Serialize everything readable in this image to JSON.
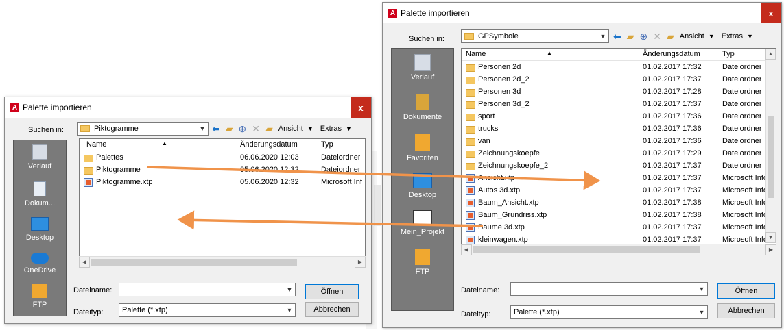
{
  "left_dialog": {
    "title": "Palette importieren",
    "close_label": "x",
    "look_in_label": "Suchen in:",
    "look_in_value": "Piktogramme",
    "view_label": "Ansicht",
    "extras_label": "Extras",
    "places": [
      {
        "label": "Verlauf",
        "icon": "history-icon"
      },
      {
        "label": "Dokum...",
        "icon": "documents-icon"
      },
      {
        "label": "Desktop",
        "icon": "desktop-icon"
      },
      {
        "label": "OneDrive",
        "icon": "onedrive-icon"
      },
      {
        "label": "FTP",
        "icon": "ftp-icon"
      }
    ],
    "columns": [
      "Name",
      "Änderungsdatum",
      "Typ"
    ],
    "rows": [
      {
        "name": "Palettes",
        "date": "06.06.2020 12:03",
        "type": "Dateiordner",
        "kind": "folder"
      },
      {
        "name": "Piktogramme",
        "date": "05.06.2020 12:32",
        "type": "Dateiordner",
        "kind": "folder"
      },
      {
        "name": "Piktogramme.xtp",
        "date": "05.06.2020 12:32",
        "type": "Microsoft Inf",
        "kind": "xtp"
      }
    ],
    "filename_label": "Dateiname:",
    "filename_value": "",
    "filetype_label": "Dateityp:",
    "filetype_value": "Palette (*.xtp)",
    "open_label": "Öffnen",
    "cancel_label": "Abbrechen"
  },
  "right_dialog": {
    "title": "Palette importieren",
    "close_label": "x",
    "look_in_label": "Suchen in:",
    "look_in_value": "GPSymbole",
    "view_label": "Ansicht",
    "extras_label": "Extras",
    "places": [
      {
        "label": "Verlauf",
        "icon": "history-icon"
      },
      {
        "label": "Dokumente",
        "icon": "documents-icon"
      },
      {
        "label": "Favoriten",
        "icon": "favorites-icon"
      },
      {
        "label": "Desktop",
        "icon": "desktop-icon"
      },
      {
        "label": "Mein_Projekt",
        "icon": "project-folder-icon"
      },
      {
        "label": "FTP",
        "icon": "ftp-icon"
      }
    ],
    "columns": [
      "Name",
      "Änderungsdatum",
      "Typ"
    ],
    "rows": [
      {
        "name": "Personen 2d",
        "date": "01.02.2017 17:32",
        "type": "Dateiordner",
        "kind": "folder"
      },
      {
        "name": "Personen 2d_2",
        "date": "01.02.2017 17:37",
        "type": "Dateiordner",
        "kind": "folder"
      },
      {
        "name": "Personen 3d",
        "date": "01.02.2017 17:28",
        "type": "Dateiordner",
        "kind": "folder"
      },
      {
        "name": "Personen 3d_2",
        "date": "01.02.2017 17:37",
        "type": "Dateiordner",
        "kind": "folder"
      },
      {
        "name": "sport",
        "date": "01.02.2017 17:36",
        "type": "Dateiordner",
        "kind": "folder"
      },
      {
        "name": "trucks",
        "date": "01.02.2017 17:36",
        "type": "Dateiordner",
        "kind": "folder"
      },
      {
        "name": "van",
        "date": "01.02.2017 17:36",
        "type": "Dateiordner",
        "kind": "folder"
      },
      {
        "name": "Zeichnungskoepfe",
        "date": "01.02.2017 17:29",
        "type": "Dateiordner",
        "kind": "folder"
      },
      {
        "name": "Zeichnungskoepfe_2",
        "date": "01.02.2017 17:37",
        "type": "Dateiordner",
        "kind": "folder"
      },
      {
        "name": "Ansicht.xtp",
        "date": "01.02.2017 17:37",
        "type": "Microsoft Info",
        "kind": "xtp"
      },
      {
        "name": "Autos 3d.xtp",
        "date": "01.02.2017 17:37",
        "type": "Microsoft Info",
        "kind": "xtp"
      },
      {
        "name": "Baum_Ansicht.xtp",
        "date": "01.02.2017 17:38",
        "type": "Microsoft Info",
        "kind": "xtp"
      },
      {
        "name": "Baum_Grundriss.xtp",
        "date": "01.02.2017 17:38",
        "type": "Microsoft Info",
        "kind": "xtp"
      },
      {
        "name": "Baume 3d.xtp",
        "date": "01.02.2017 17:37",
        "type": "Microsoft Info",
        "kind": "xtp"
      },
      {
        "name": "kleinwagen.xtp",
        "date": "01.02.2017 17:37",
        "type": "Microsoft Info",
        "kind": "xtp"
      }
    ],
    "filename_label": "Dateiname:",
    "filename_value": "",
    "filetype_label": "Dateityp:",
    "filetype_value": "Palette (*.xtp)",
    "open_label": "Öffnen",
    "cancel_label": "Abbrechen"
  },
  "colors": {
    "arrow": "#f0934a",
    "close": "#c42b1c",
    "places_bg": "#7a7a7a",
    "folder": "#f5c760"
  }
}
